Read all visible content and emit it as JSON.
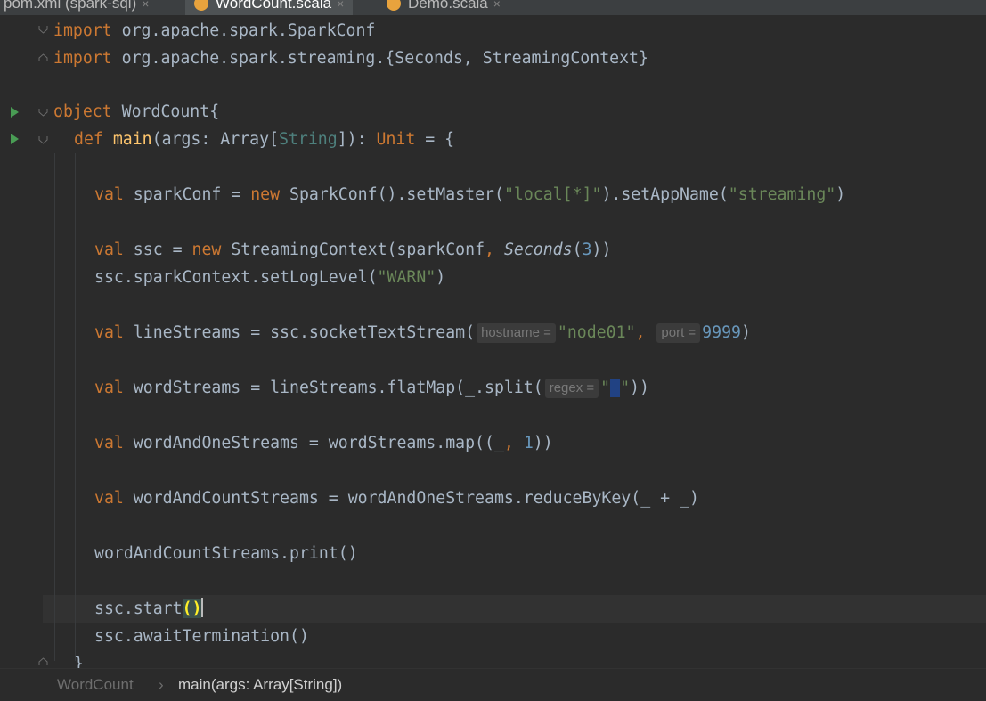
{
  "tabs": [
    {
      "label": "pom.xml (spark-sql)",
      "active": false,
      "icon": null
    },
    {
      "label": "WordCount.scala",
      "active": true,
      "icon": "scala-object-icon"
    },
    {
      "label": "Demo.scala",
      "active": false,
      "icon": "scala-object-icon"
    }
  ],
  "tab_close_glyph": "×",
  "code": {
    "line1": {
      "kw": "import",
      "rest": " org.apache.spark.SparkConf"
    },
    "line2": {
      "kw": "import",
      "rest": " org.apache.spark.streaming.{Seconds, StreamingContext}"
    },
    "line4": {
      "kw": "object",
      "rest": " WordCount{"
    },
    "line5": {
      "kw": "def",
      "name": "main",
      "p1": "(args: Array[",
      "type": "String",
      "p2": "]): ",
      "unit": "Unit",
      "p3": " = {"
    },
    "line7": {
      "kw": "val",
      "a": " sparkConf = ",
      "kw2": "new",
      "b": " SparkConf().setMaster(",
      "s1": "\"local[*]\"",
      "c": ").setAppName(",
      "s2": "\"streaming\"",
      "d": ")"
    },
    "line9": {
      "kw": "val",
      "a": " ssc = ",
      "kw2": "new",
      "b": " StreamingContext(sparkConf",
      "comma": ", ",
      "sec": "Seconds",
      "c": "(",
      "n": "3",
      "d": "))"
    },
    "line10": {
      "a": "ssc.sparkContext.setLogLevel(",
      "s": "\"WARN\"",
      "b": ")"
    },
    "line12": {
      "kw": "val",
      "a": " lineStreams = ssc.socketTextStream(",
      "hint1": "hostname =",
      "s": "\"node01\"",
      "comma": ",",
      "hint2": "port =",
      "n": "9999",
      "b": ")"
    },
    "line14": {
      "kw": "val",
      "a": " wordStreams = lineStreams.flatMap(_.split(",
      "hint": "regex =",
      "q1": "\"",
      "space": " ",
      "q2": "\"",
      "b": "))"
    },
    "line16": {
      "kw": "val",
      "a": " wordAndOneStreams = wordStreams.map((_",
      "comma": ", ",
      "n": "1",
      "b": "))"
    },
    "line18": {
      "kw": "val",
      "a": " wordAndCountStreams = wordAndOneStreams.reduceByKey(_ + _)"
    },
    "line20": {
      "a": "wordAndCountStreams.print()"
    },
    "line22": {
      "a": "ssc.start",
      "paren": "()"
    },
    "line23": {
      "a": "ssc.awaitTermination()"
    },
    "line24": {
      "a": "}"
    }
  },
  "breadcrumbs": {
    "first": "WordCount",
    "separator": "›",
    "second": "main(args: Array[String])"
  },
  "colors": {
    "keyword": "#cc7832",
    "string": "#6a8759",
    "number": "#6897bb",
    "type": "#4e807d",
    "function": "#ffc66d",
    "text": "#a9b7c6",
    "background": "#2b2b2b"
  }
}
